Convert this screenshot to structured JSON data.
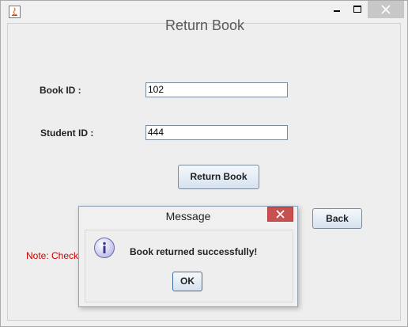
{
  "window": {
    "title": ""
  },
  "form": {
    "heading": "Return Book",
    "book_id_label": "Book ID :",
    "book_id_value": "102",
    "student_id_label": "Student ID :",
    "student_id_value": "444",
    "return_button": "Return Book",
    "back_button": "Back",
    "note": "Note: Check"
  },
  "dialog": {
    "title": "Message",
    "message": "Book returned successfully!",
    "ok_button": "OK"
  },
  "icons": {
    "app": "java-icon",
    "minimize": "minimize-icon",
    "maximize": "maximize-icon",
    "close": "close-icon",
    "info": "info-icon"
  }
}
